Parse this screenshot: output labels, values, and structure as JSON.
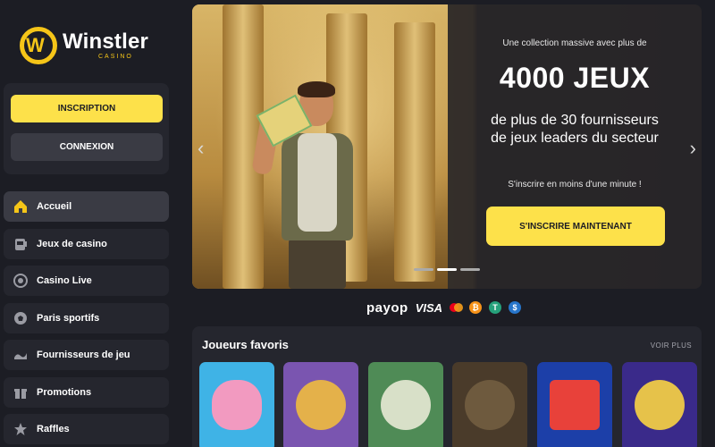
{
  "brand": {
    "name": "Winstler",
    "subtitle": "CASINO"
  },
  "auth": {
    "signup_label": "INSCRIPTION",
    "login_label": "CONNEXION"
  },
  "nav": {
    "items": [
      {
        "label": "Accueil",
        "icon": "home-icon",
        "active": true
      },
      {
        "label": "Jeux de casino",
        "icon": "slot-machine-icon",
        "active": false
      },
      {
        "label": "Casino Live",
        "icon": "live-chip-icon",
        "active": false
      },
      {
        "label": "Paris sportifs",
        "icon": "soccer-ball-icon",
        "active": false
      },
      {
        "label": "Fournisseurs de jeu",
        "icon": "providers-icon",
        "active": false
      },
      {
        "label": "Promotions",
        "icon": "gift-icon",
        "active": false
      },
      {
        "label": "Raffles",
        "icon": "star-icon",
        "active": false
      }
    ]
  },
  "hero": {
    "kicker": "Une collection massive avec plus de",
    "title": "4000 JEUX",
    "subtitle": "de plus de 30 fournisseurs de jeux leaders du secteur",
    "note": "S'inscrire en moins d'une minute !",
    "cta_label": "S'INSCRIRE MAINTENANT",
    "prev_arrow": "‹",
    "next_arrow": "›",
    "slides_count": 3,
    "active_slide": 2
  },
  "payments": {
    "payop": "payop",
    "visa": "VISA",
    "crypto": [
      {
        "name": "bitcoin-icon",
        "glyph": "₿",
        "color": "#f7931a"
      },
      {
        "name": "tether-icon",
        "glyph": "T",
        "color": "#26a17b"
      },
      {
        "name": "usdc-icon",
        "glyph": "$",
        "color": "#2775ca"
      }
    ]
  },
  "favorites": {
    "title": "Joueurs favoris",
    "see_more": "VOIR PLUS",
    "games": [
      {
        "name": "game-piggy",
        "bg": "#3fb3e6",
        "art": "#f29ac0"
      },
      {
        "name": "game-party-punk",
        "bg": "#7a55b0",
        "art": "#e4b14a"
      },
      {
        "name": "game-skeleton",
        "bg": "#4f8b56",
        "art": "#d8e0c8"
      },
      {
        "name": "game-gasmask",
        "bg": "#4a3b2a",
        "art": "#6e5a3e"
      },
      {
        "name": "game-slots-red",
        "bg": "#1c3fa8",
        "art": "#e8413a"
      },
      {
        "name": "game-viking",
        "bg": "#3a2a8a",
        "art": "#e6c24a"
      }
    ]
  },
  "colors": {
    "accent": "#fde14a",
    "background": "#1c1d24",
    "panel": "#25262e"
  }
}
